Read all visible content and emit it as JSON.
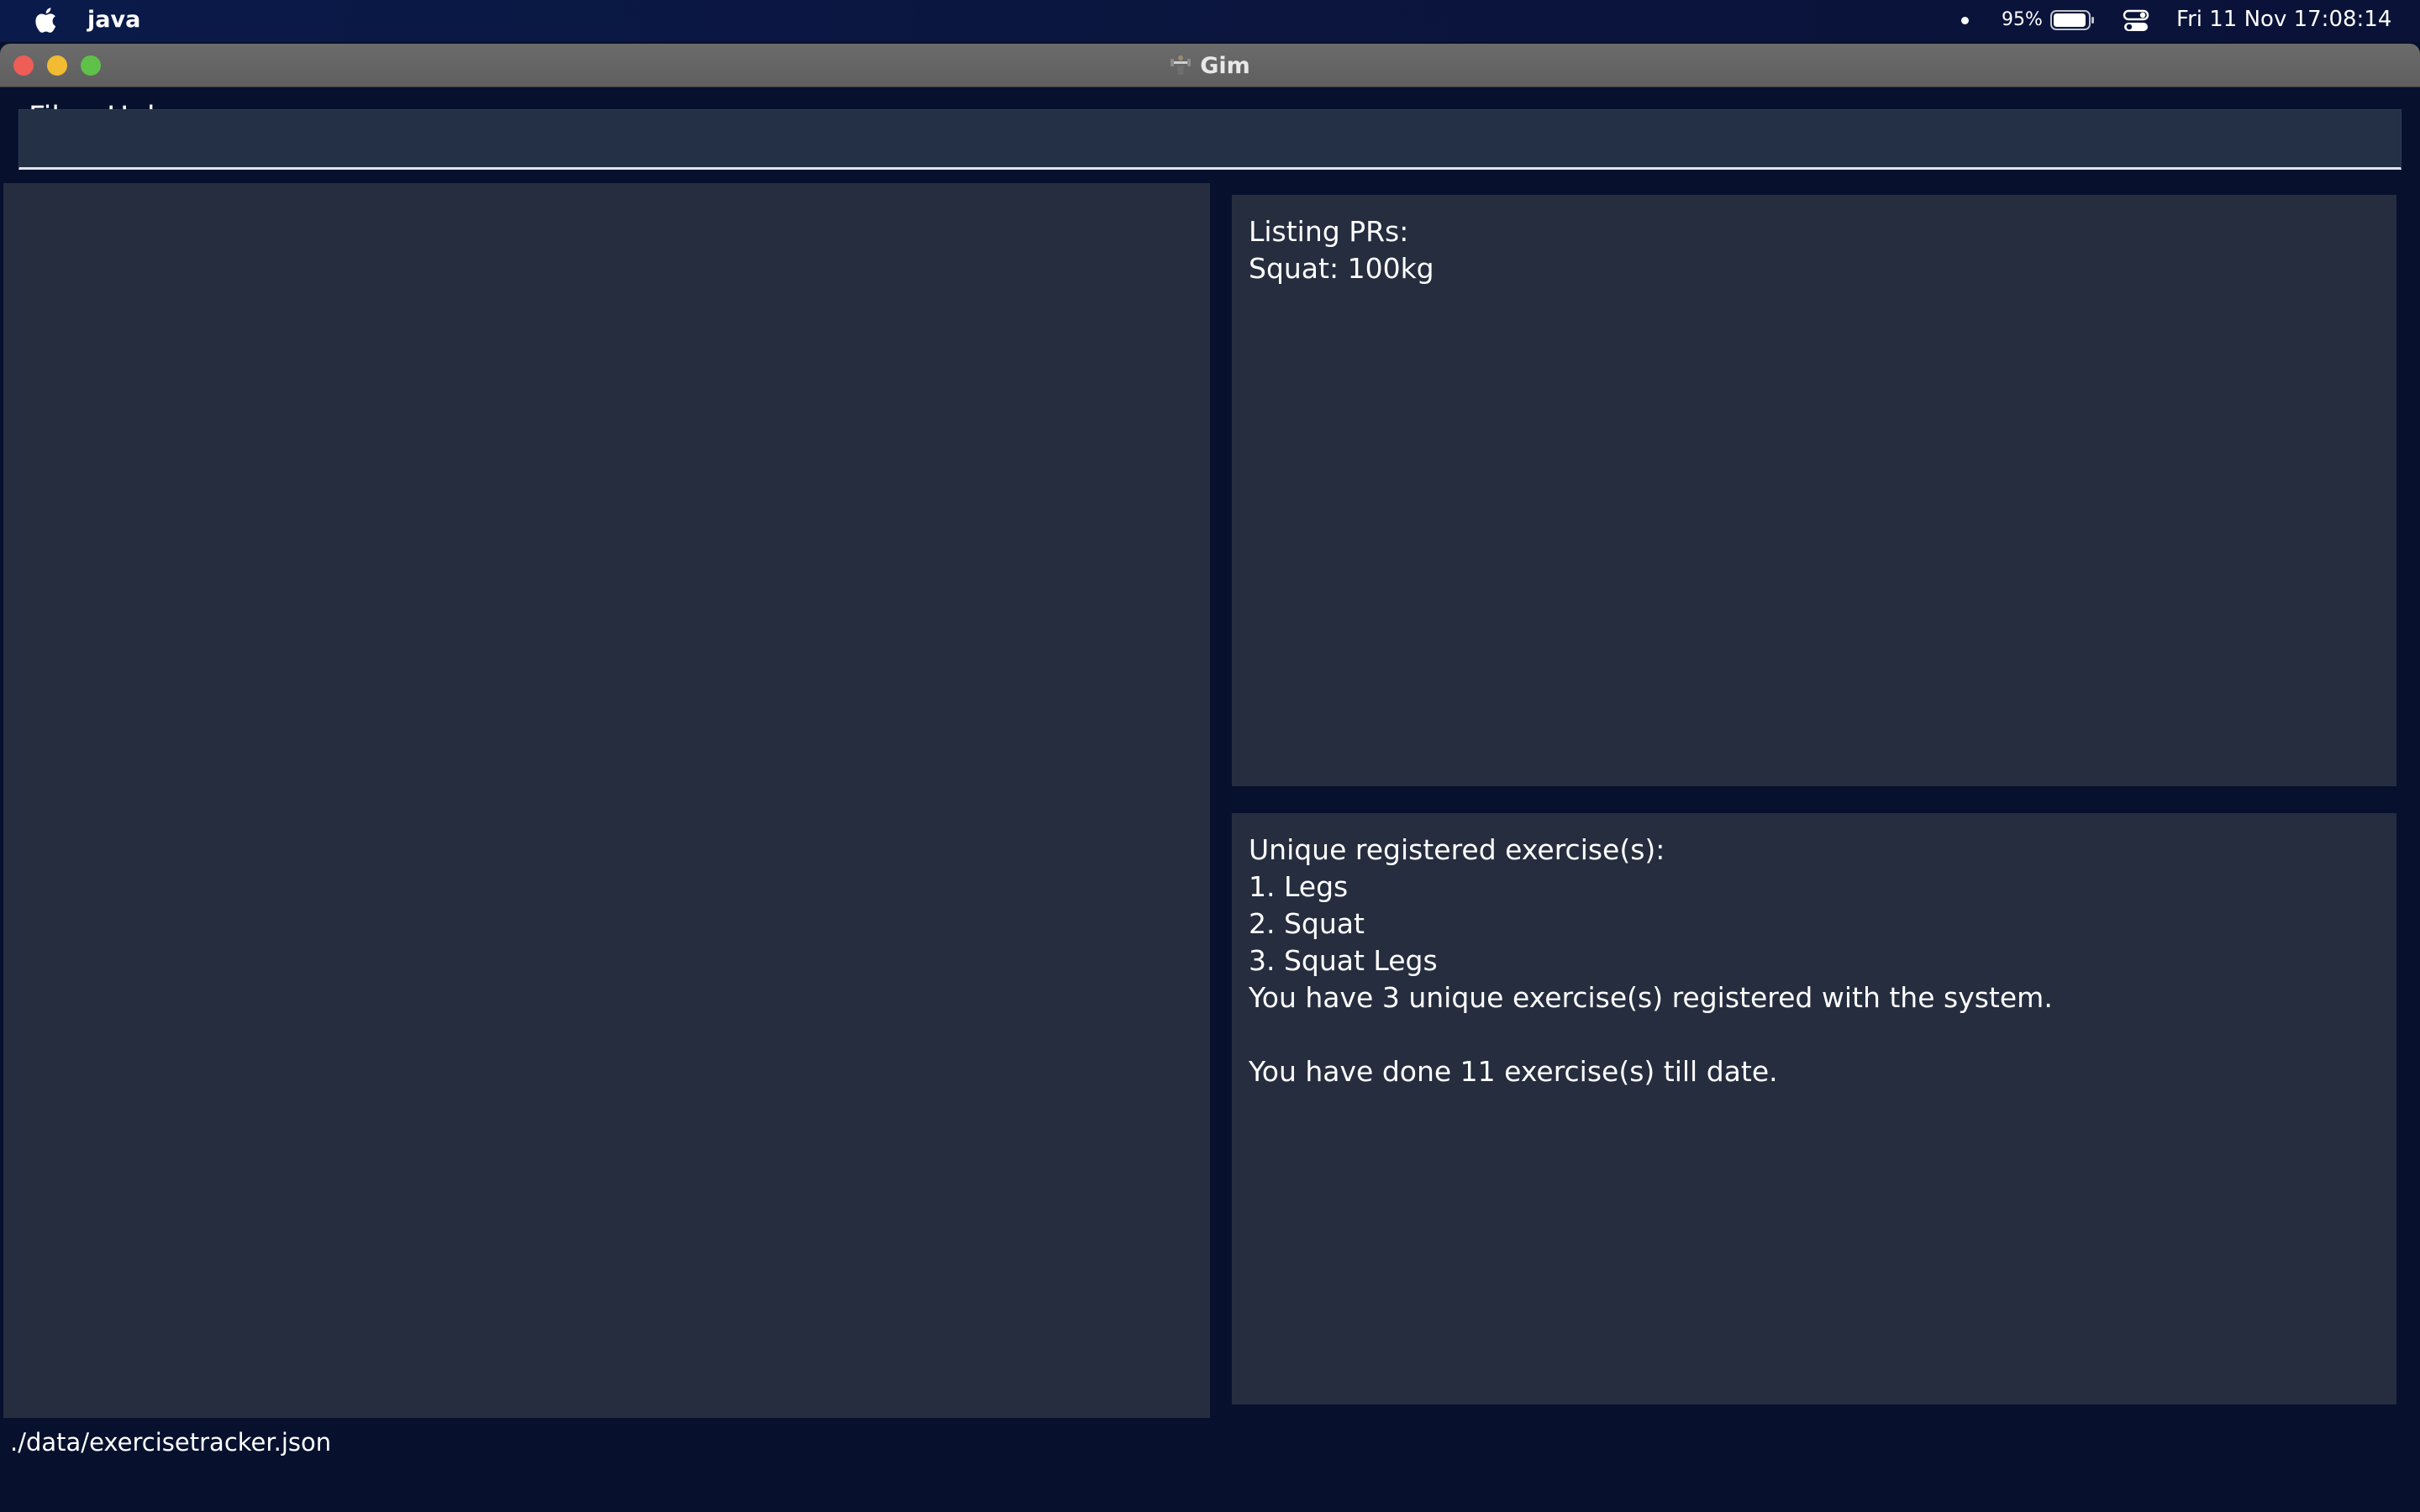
{
  "menubar": {
    "app_name": "java",
    "battery_percent": "95%",
    "datetime": "Fri 11 Nov  17:08:14"
  },
  "window": {
    "title": "Gim",
    "menus": [
      "File",
      "Help"
    ]
  },
  "command_box": {
    "value": "",
    "placeholder": ""
  },
  "pr_panel": {
    "lines": [
      "Listing PRs:",
      "Squat: 100kg"
    ]
  },
  "exercise_panel": {
    "lines": [
      "Unique registered exercise(s):",
      "1. Legs",
      "2. Squat",
      "3. Squat Legs",
      "You have 3 unique exercise(s) registered with the system.",
      "",
      "You have done 11 exercise(s) till date."
    ]
  },
  "status_bar": {
    "file_path": "./data/exercisetracker.json"
  },
  "icons": {
    "apple": "apple-logo-icon",
    "battery": "battery-icon",
    "control_center": "control-center-icon",
    "app": "dumbbell-icon"
  },
  "colors": {
    "background": "#07112e",
    "panel": "#252d3f",
    "close": "#ee5d56",
    "minimize": "#f1bc32",
    "maximize": "#5fc14a"
  }
}
